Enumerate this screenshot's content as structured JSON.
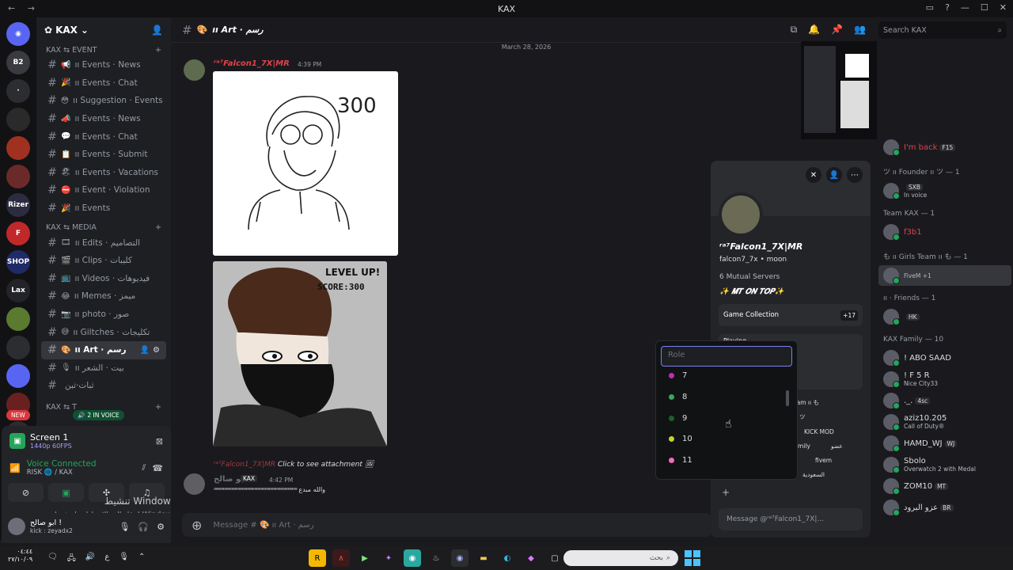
{
  "window": {
    "title": "KAX",
    "controls": [
      "▭",
      "?",
      "—",
      "☐",
      "✕"
    ]
  },
  "servers": [
    {
      "label": "B2"
    },
    {
      "label": "·"
    },
    {
      "label": ""
    },
    {
      "label": "",
      "badge": "1"
    },
    {
      "label": "",
      "badge": "2"
    },
    {
      "label": "Rizer"
    },
    {
      "label": "F"
    },
    {
      "label": "SHOP"
    },
    {
      "label": "Lax",
      "badge": "9"
    },
    {
      "label": ""
    },
    {
      "label": ""
    },
    {
      "label": ""
    },
    {
      "label": ""
    },
    {
      "label": "",
      "badge": "10"
    }
  ],
  "new_badge": "NEW",
  "guild": {
    "name": "KAX"
  },
  "categories": {
    "event": "KAX ⇆ EVENT",
    "media": "KAX ⇆ MEDIA",
    "third": "KAX ⇆ T"
  },
  "event_channels": [
    {
      "emoji": "📢",
      "name": "ıı Events · News"
    },
    {
      "emoji": "🎉",
      "name": "ıı Events · Chat"
    },
    {
      "emoji": "😳",
      "name": "ıı Suggestion · Events"
    },
    {
      "emoji": "📣",
      "name": "ıı Events · News"
    },
    {
      "emoji": "💬",
      "name": "ıı Events · Chat"
    },
    {
      "emoji": "📋",
      "name": "ıı Events · Submit"
    },
    {
      "emoji": "🏖",
      "name": "ıı Events · Vacations"
    },
    {
      "emoji": "⛔",
      "name": "ıı Event · Violation"
    },
    {
      "emoji": "🎉",
      "name": "ıı Events"
    }
  ],
  "media_channels": [
    {
      "emoji": "🎞",
      "name": "ıı Edits · التصاميم"
    },
    {
      "emoji": "🎬",
      "name": "ıı Clips · كليبات"
    },
    {
      "emoji": "📺",
      "name": "ıı Videos · فيديوهات"
    },
    {
      "emoji": "😂",
      "name": "ıı Memes · ميمز"
    },
    {
      "emoji": "📷",
      "name": "ıı photo · صور"
    },
    {
      "emoji": "😅",
      "name": "ıı Giltches · تكليجات"
    },
    {
      "emoji": "🎨",
      "name": "ıı Art · رسم",
      "active": true
    },
    {
      "emoji": "🎙",
      "name": "ıı بيت · الشعر"
    },
    {
      "emoji": "",
      "name": "ثبات·ثبن"
    }
  ],
  "in_voice": "2 IN VOICE",
  "voice": {
    "screen_title": "Screen 1",
    "screen_quality": "1440p 60FPS",
    "connected": "Voice Connected",
    "location": "RISK 🌐 / KAX"
  },
  "user": {
    "name": "ابو صالح !",
    "status": "kick : zeyadx2"
  },
  "windows_activate": {
    "title": "تنشيط Windows",
    "subtitle": "انتقل إلى الإعدادات لتنشيط Windows"
  },
  "channel_header": {
    "name": "ıı Art · رسم"
  },
  "search_placeholder": "Search KAX",
  "date_divider": "March 28, 2026",
  "message1": {
    "author": "ʳᵃ⁷Falcon1_7X|MR",
    "time": "4:39 PM"
  },
  "art_text": {
    "number": "300",
    "level": "LEVEL UP!",
    "score": "SCORE:300"
  },
  "message2": {
    "reply_author": "ʳᵃ⁷Falcon1_7X|MR",
    "reply_text": "Click to see attachment",
    "author": "ابو صالح",
    "tag": "KAX",
    "time": "4:42 PM",
    "text": "ᵃᵃᵃᵃᵃᵃᵃᵃᵃᵃᵃᵃᵃᵃᵃᵃᵃᵃᵃᵃᵃᵃᵃᵃᵃᵃᵃᵃᵃᵃᵃᵃᵃᵃᵃᵃᵃᵃᵃᵃ والله مبدع"
  },
  "composer_placeholder": "Message # 🎨 ıı Art · رسم",
  "profile": {
    "display_name": "ʳᵃ⁷Falcon1_7X|MR",
    "username": "falcon7_7x • moon",
    "mutual": "6 Mutual Servers",
    "bio": "✨ 𝑴𝑻 𝑶𝑵 𝑻𝑶𝑷✨",
    "game_collection": "Game Collection",
    "game_more": "+17",
    "playing": "Playing",
    "roles": [
      "eam ıı も",
      "ツ",
      "KICK MOD",
      "mily",
      "عضو",
      "fivem",
      "السعودية"
    ],
    "message_placeholder": "Message @ʳᵃ⁷Falcon1_7X|..."
  },
  "role_picker": {
    "placeholder": "Role",
    "items": [
      {
        "label": "7",
        "color": "#c42ab7"
      },
      {
        "label": "8",
        "color": "#3ba55d"
      },
      {
        "label": "9",
        "color": "#1f5f2e"
      },
      {
        "label": "10",
        "color": "#c7d32a"
      },
      {
        "label": "11",
        "color": "#e96fc5"
      }
    ]
  },
  "members": {
    "top": [
      {
        "name": "I'm back",
        "tag": "F15",
        "red": true
      }
    ],
    "groups": [
      {
        "title": "ツ ıı Founder ıı ツ — 1",
        "members": [
          {
            "name": "",
            "tag": "SXB",
            "status": "In voice"
          }
        ]
      },
      {
        "title": "Team KAX — 1",
        "members": [
          {
            "name": "f3b1",
            "red": true
          }
        ]
      },
      {
        "title": "も ıı Girls Team ıı も — 1",
        "members": [
          {
            "name": "",
            "status": "FiveM +1",
            "highlight": true
          }
        ]
      },
      {
        "title": "ıı · Friends — 1",
        "members": [
          {
            "name": "",
            "tag": "HK"
          }
        ]
      },
      {
        "title": "KAX Family — 10",
        "members": [
          {
            "name": "! ABO SAAD"
          },
          {
            "name": "! F 5 R",
            "status": "Nice City33"
          },
          {
            "name": "._.",
            "tag": "4sc"
          },
          {
            "name": "aziz10.205",
            "status": "Call of Duty®"
          },
          {
            "name": "HAMD_WJ",
            "tag": "WJ"
          },
          {
            "name": "Sbolo",
            "status": "Overwatch 2 with Medal"
          },
          {
            "name": "ZOM10",
            "tag": "MT"
          },
          {
            "name": "عزو البرود",
            "tag": "BR"
          }
        ]
      }
    ]
  },
  "taskbar": {
    "time": "٠٤:٤٤",
    "date": "٢٧/١٠/٠٩",
    "lang": "ع",
    "search_placeholder": "بحث"
  },
  "colors": {
    "accent": "#5865f2",
    "online": "#23a55a",
    "danger": "#da373c",
    "name_red": "#e0424b"
  }
}
